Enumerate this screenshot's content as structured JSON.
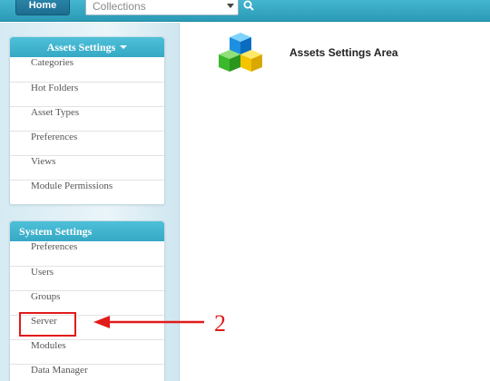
{
  "topbar": {
    "home_label": "Home",
    "collections_placeholder": "Collections"
  },
  "assets_panel": {
    "title": "Assets Settings",
    "items": [
      "Categories",
      "Hot Folders",
      "Asset Types",
      "Preferences",
      "Views",
      "Module Permissions"
    ]
  },
  "system_panel": {
    "title": "System Settings",
    "items": [
      "Preferences",
      "Users",
      "Groups",
      "Server",
      "Modules",
      "Data Manager"
    ]
  },
  "main": {
    "title": "Assets Settings Area",
    "icon": "cubes-icon"
  },
  "annotation": {
    "step_number": "2",
    "target": "Server",
    "color": "#e11b1b"
  },
  "colors": {
    "accent": "#35a8c5",
    "topbar": "#2a9ab6"
  }
}
